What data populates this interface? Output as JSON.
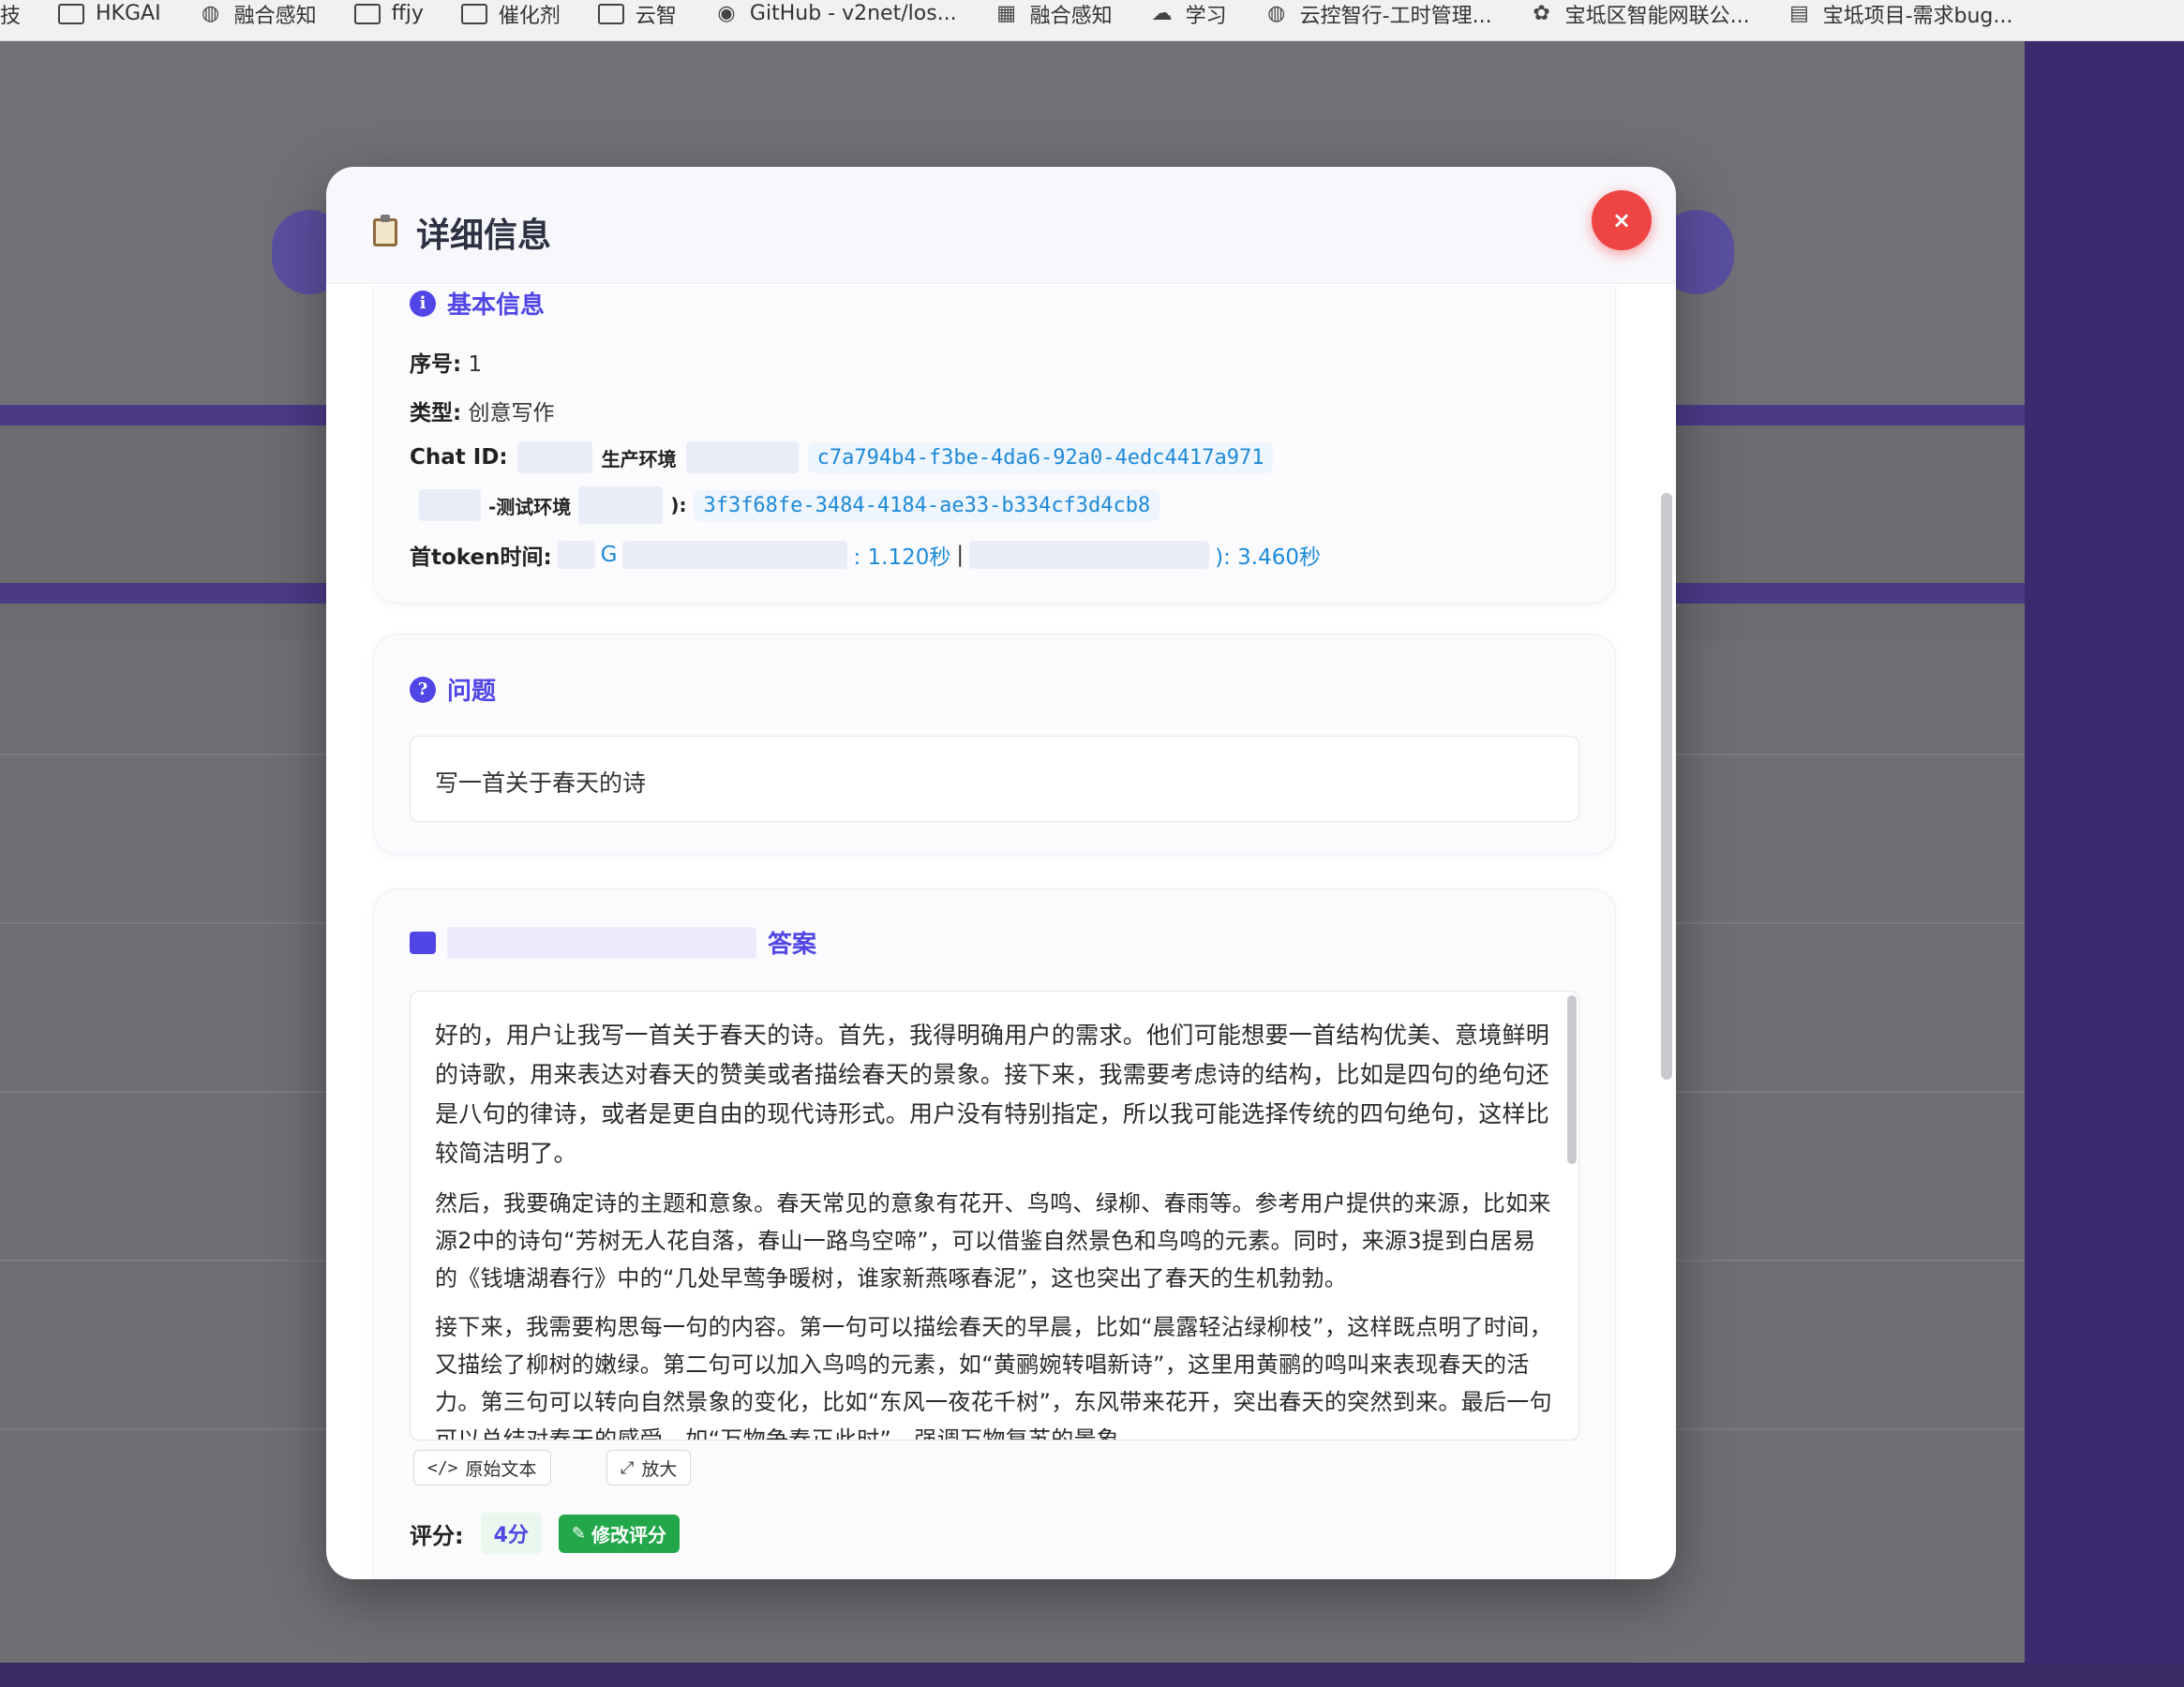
{
  "bookmarks": [
    {
      "label": "技",
      "icon": "none"
    },
    {
      "label": "HKGAI",
      "icon": "folder-icon"
    },
    {
      "label": "融合感知",
      "icon": "globe-icon"
    },
    {
      "label": "ffjy",
      "icon": "folder-icon"
    },
    {
      "label": "催化剂",
      "icon": "folder-icon"
    },
    {
      "label": "云智",
      "icon": "folder-icon"
    },
    {
      "label": "GitHub - v2net/los...",
      "icon": "github-icon"
    },
    {
      "label": "融合感知",
      "icon": "grid-icon"
    },
    {
      "label": "学习",
      "icon": "cloud-icon"
    },
    {
      "label": "云控智行-工时管理...",
      "icon": "globe-icon"
    },
    {
      "label": "宝坻区智能网联公...",
      "icon": "gear-icon"
    },
    {
      "label": "宝坻项目-需求bug...",
      "icon": "doc-icon"
    }
  ],
  "modal": {
    "title": "详细信息",
    "close_label": "×",
    "basic": {
      "title": "基本信息",
      "seq_label": "序号:",
      "seq_value": "1",
      "type_label": "类型:",
      "type_value": "创意写作",
      "chat_id_label": "Chat ID:",
      "prod_env_label": "生产环境",
      "prod_chat_id": "c7a794b4-f3be-4da6-92a0-4edc4417a971",
      "test_env_label": "-测试环境",
      "test_suffix": "):",
      "test_chat_id": "3f3f68fe-3484-4184-ae33-b334cf3d4cb8",
      "token_label": "首token时间:",
      "token_prefix": "G",
      "token_first": ": 1.120秒",
      "token_sep": "|",
      "token_second": "): 3.460秒"
    },
    "question": {
      "title": "问题",
      "text": "写一首关于春天的诗"
    },
    "answer": {
      "title": "答案",
      "paragraphs": [
        "好的，用户让我写一首关于春天的诗。首先，我得明确用户的需求。他们可能想要一首结构优美、意境鲜明的诗歌，用来表达对春天的赞美或者描绘春天的景象。接下来，我需要考虑诗的结构，比如是四句的绝句还是八句的律诗，或者是更自由的现代诗形式。用户没有特别指定，所以我可能选择传统的四句绝句，这样比较简洁明了。",
        "然后，我要确定诗的主题和意象。春天常见的意象有花开、鸟鸣、绿柳、春雨等。参考用户提供的来源，比如来源2中的诗句“芳树无人花自落，春山一路鸟空啼”，可以借鉴自然景色和鸟鸣的元素。同时，来源3提到白居易的《钱塘湖春行》中的“几处早莺争暖树，谁家新燕啄春泥”，这也突出了春天的生机勃勃。",
        "接下来，我需要构思每一句的内容。第一句可以描绘春天的早晨，比如“晨露轻沾绿柳枝”，这样既点明了时间，又描绘了柳树的嫩绿。第二句可以加入鸟鸣的元素，如“黄鹂婉转唱新诗”，这里用黄鹂的鸣叫来表现春天的活力。第三句可以转向自然景象的变化，比如“东风一夜花千树”，东风带来花开，突出春天的突然到来。最后一句可以总结对春天的感受，如“万物争春正此时”，强调万物复苏的景象。"
      ],
      "raw_button": "原始文本",
      "zoom_button": "放大",
      "score_label": "评分:",
      "score_value": "4分",
      "edit_score_button": "修改评分"
    }
  }
}
